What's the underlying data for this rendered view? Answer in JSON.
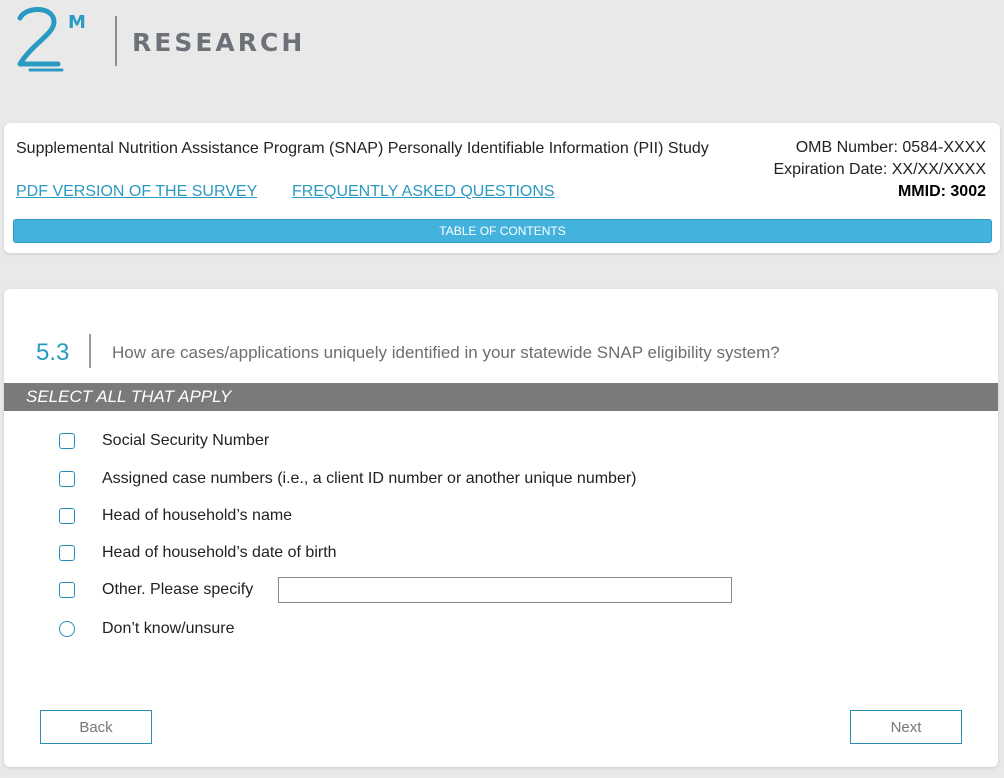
{
  "logo": {
    "mark": "2M",
    "brand": "RESEARCH"
  },
  "header": {
    "study_title": "Supplemental Nutrition Assistance Program (SNAP) Personally Identifiable Information (PII) Study",
    "omb_number": "OMB Number: 0584-XXXX",
    "expiration_date": "Expiration Date: XX/XX/XXXX",
    "mmid": "MMID: 3002",
    "pdf_link": "PDF VERSION OF THE SURVEY",
    "faq_link": "FREQUENTLY ASKED QUESTIONS",
    "toc_label": "TABLE OF CONTENTS"
  },
  "question": {
    "number": "5.3",
    "text": "How are cases/applications uniquely identified in your statewide SNAP eligibility system?",
    "instruction": "SELECT ALL THAT APPLY",
    "options": [
      {
        "label": "Social Security Number",
        "type": "checkbox"
      },
      {
        "label": "Assigned case numbers (i.e., a client ID number or another unique number)",
        "type": "checkbox"
      },
      {
        "label": "Head of household’s name",
        "type": "checkbox"
      },
      {
        "label": "Head of household’s date of birth",
        "type": "checkbox"
      },
      {
        "label": "Other. Please specify",
        "type": "checkbox"
      },
      {
        "label": "Don’t know/unsure",
        "type": "radio"
      }
    ],
    "other_specify_value": ""
  },
  "navigation": {
    "back_label": "Back",
    "next_label": "Next"
  },
  "colors": {
    "accent": "#2a9ac2",
    "toc_bar": "#43b3de",
    "instruction_bar": "#7a7a7d",
    "page_background": "#e9e9e9"
  }
}
